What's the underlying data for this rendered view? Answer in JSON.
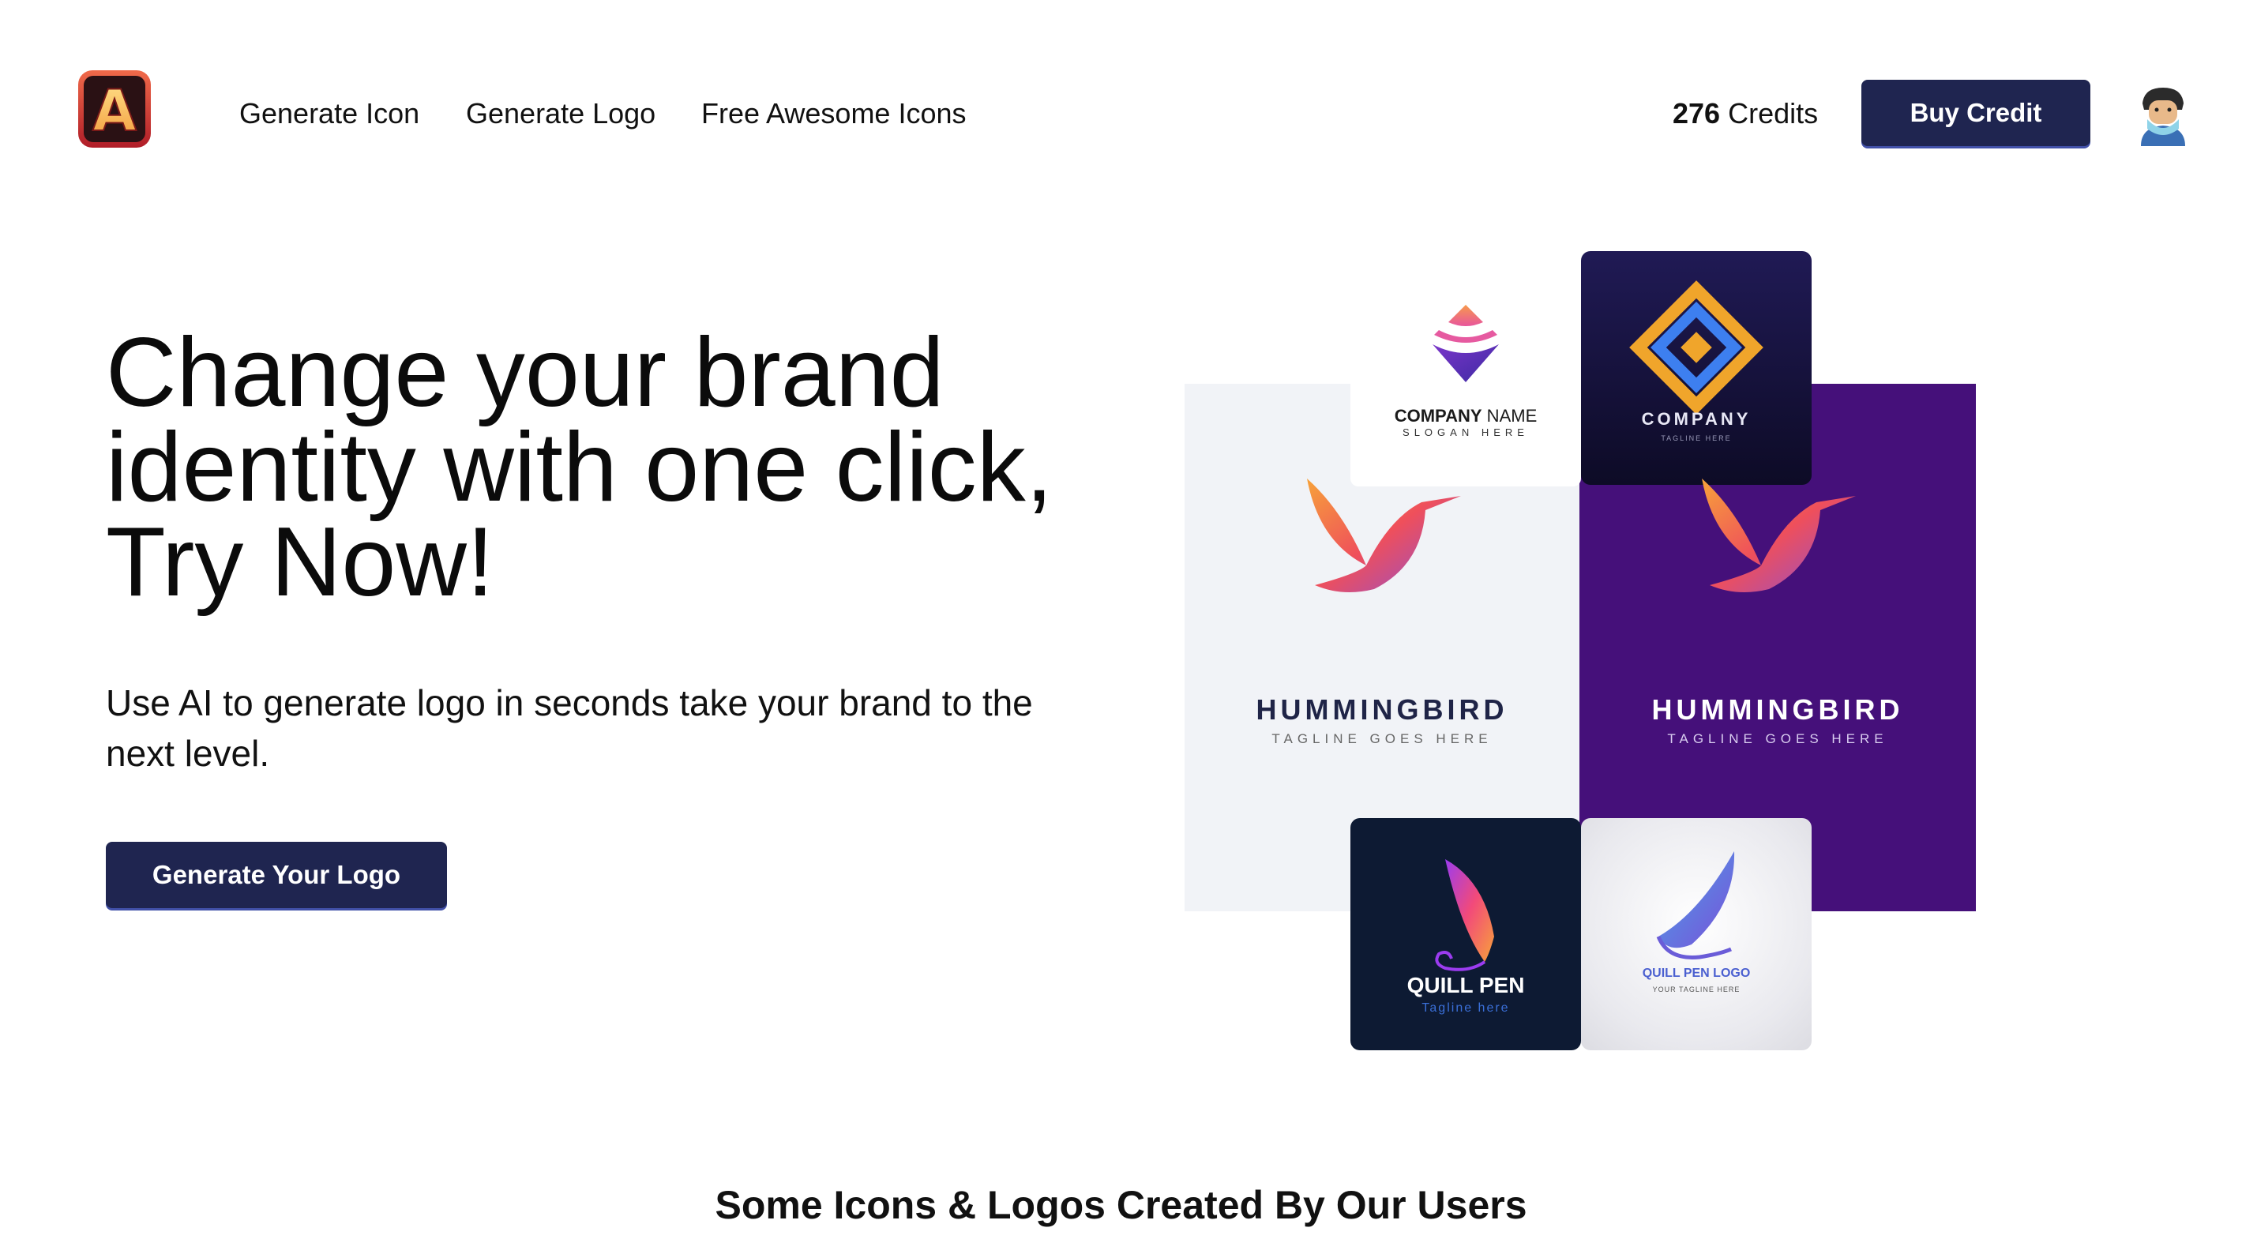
{
  "header": {
    "logo_letter": "A",
    "nav": [
      {
        "label": "Generate Icon"
      },
      {
        "label": "Generate Logo"
      },
      {
        "label": "Free Awesome Icons"
      }
    ],
    "credits_count": "276",
    "credits_label": "Credits",
    "buy_button": "Buy Credit"
  },
  "hero": {
    "title": "Change your brand identity with one click, Try Now!",
    "subtitle": "Use AI to generate logo in seconds take your brand to the next level.",
    "cta": "Generate Your Logo"
  },
  "collage": {
    "company_white": {
      "name_bold": "COMPANY",
      "name_rest": " NAME",
      "slogan": "SLOGAN HERE"
    },
    "company_dark": {
      "name": "COMPANY",
      "tagline": "TAGLINE HERE"
    },
    "hummingbird_light": {
      "name": "HUMMINGBIRD",
      "tagline": "TAGLINE GOES HERE"
    },
    "hummingbird_dark": {
      "name": "HUMMINGBIRD",
      "tagline": "TAGLINE GOES HERE"
    },
    "quill_dark": {
      "name": "QUILL PEN",
      "tagline": "Tagline here"
    },
    "quill_light": {
      "name": "QUILL PEN LOGO",
      "tagline": "YOUR TAGLINE HERE"
    }
  },
  "showcase": {
    "heading": "Some Icons & Logos Created By Our Users"
  },
  "colors": {
    "primary_button": "#1f2550",
    "purple_tile": "#45107a",
    "light_tile": "#f1f3f7"
  }
}
